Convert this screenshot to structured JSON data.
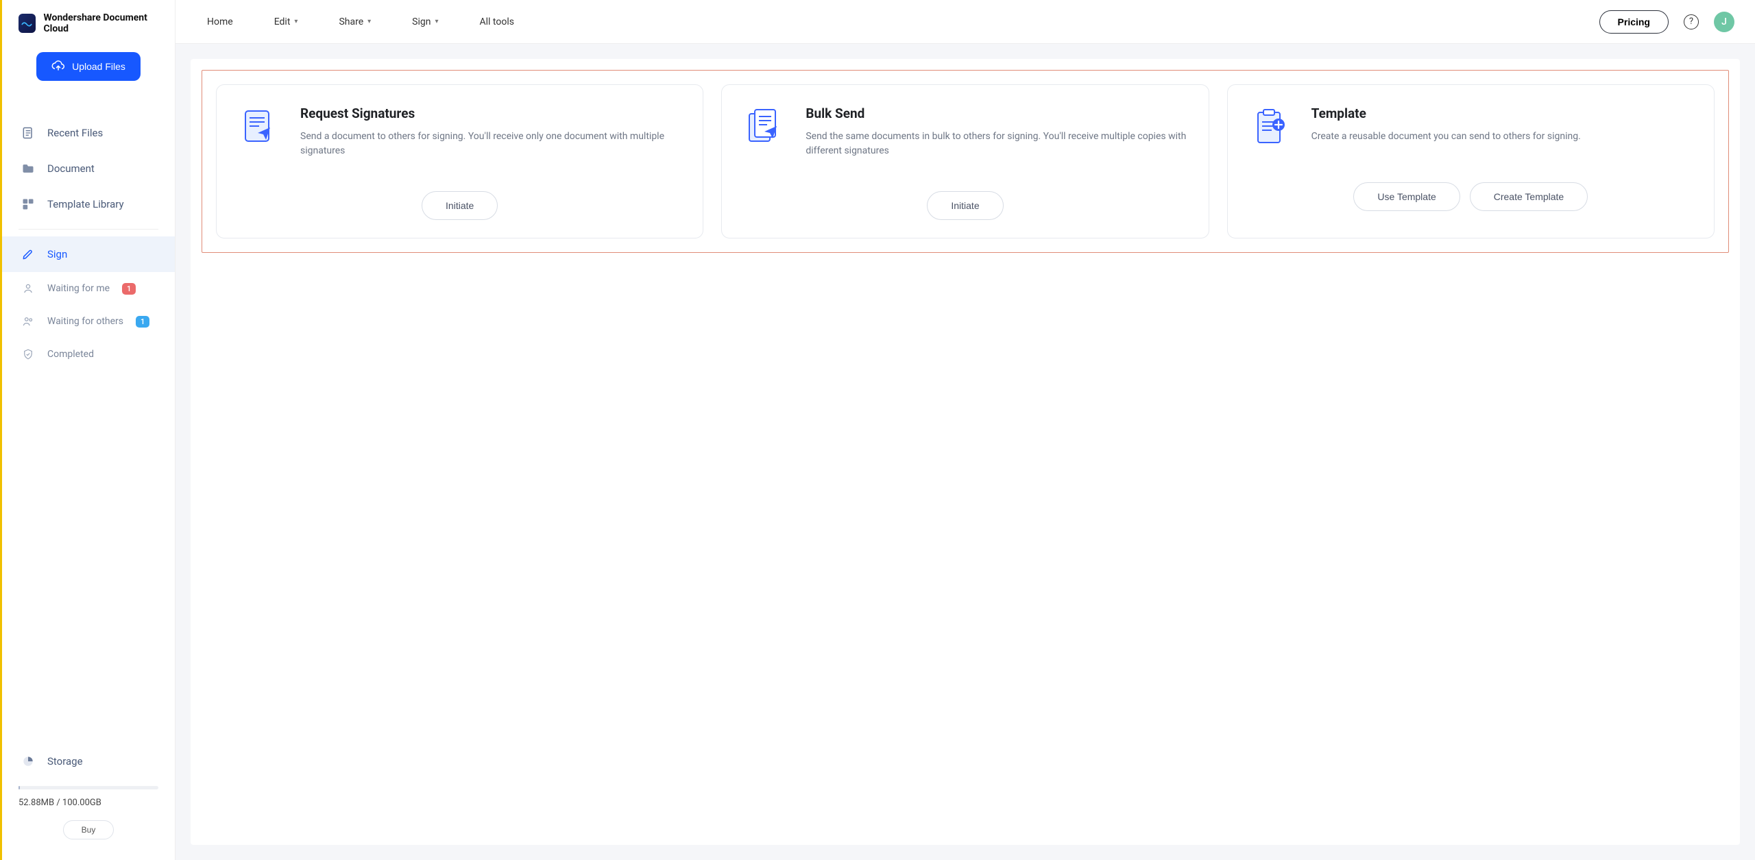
{
  "brand": {
    "name": "Wondershare Document Cloud"
  },
  "sidebar": {
    "upload_label": "Upload Files",
    "items": [
      {
        "label": "Recent Files"
      },
      {
        "label": "Document"
      },
      {
        "label": "Template Library"
      }
    ],
    "sign_label": "Sign",
    "sub": [
      {
        "label": "Waiting for me",
        "badge": "1"
      },
      {
        "label": "Waiting for others",
        "badge": "1"
      },
      {
        "label": "Completed"
      }
    ],
    "storage_label": "Storage",
    "storage_text": "52.88MB / 100.00GB",
    "buy_label": "Buy"
  },
  "topnav": {
    "home": "Home",
    "edit": "Edit",
    "share": "Share",
    "sign": "Sign",
    "all_tools": "All tools",
    "pricing": "Pricing",
    "avatar_initial": "J"
  },
  "cards": [
    {
      "title": "Request Signatures",
      "desc": "Send a document to others for signing. You'll receive only one document with multiple signatures",
      "buttons": [
        {
          "label": "Initiate"
        }
      ]
    },
    {
      "title": "Bulk Send",
      "desc": "Send the same documents in bulk to others for signing. You'll receive multiple copies with different signatures",
      "buttons": [
        {
          "label": "Initiate"
        }
      ]
    },
    {
      "title": "Template",
      "desc": "Create a reusable document you can send to others for signing.",
      "buttons": [
        {
          "label": "Use Template"
        },
        {
          "label": "Create Template"
        }
      ]
    }
  ]
}
